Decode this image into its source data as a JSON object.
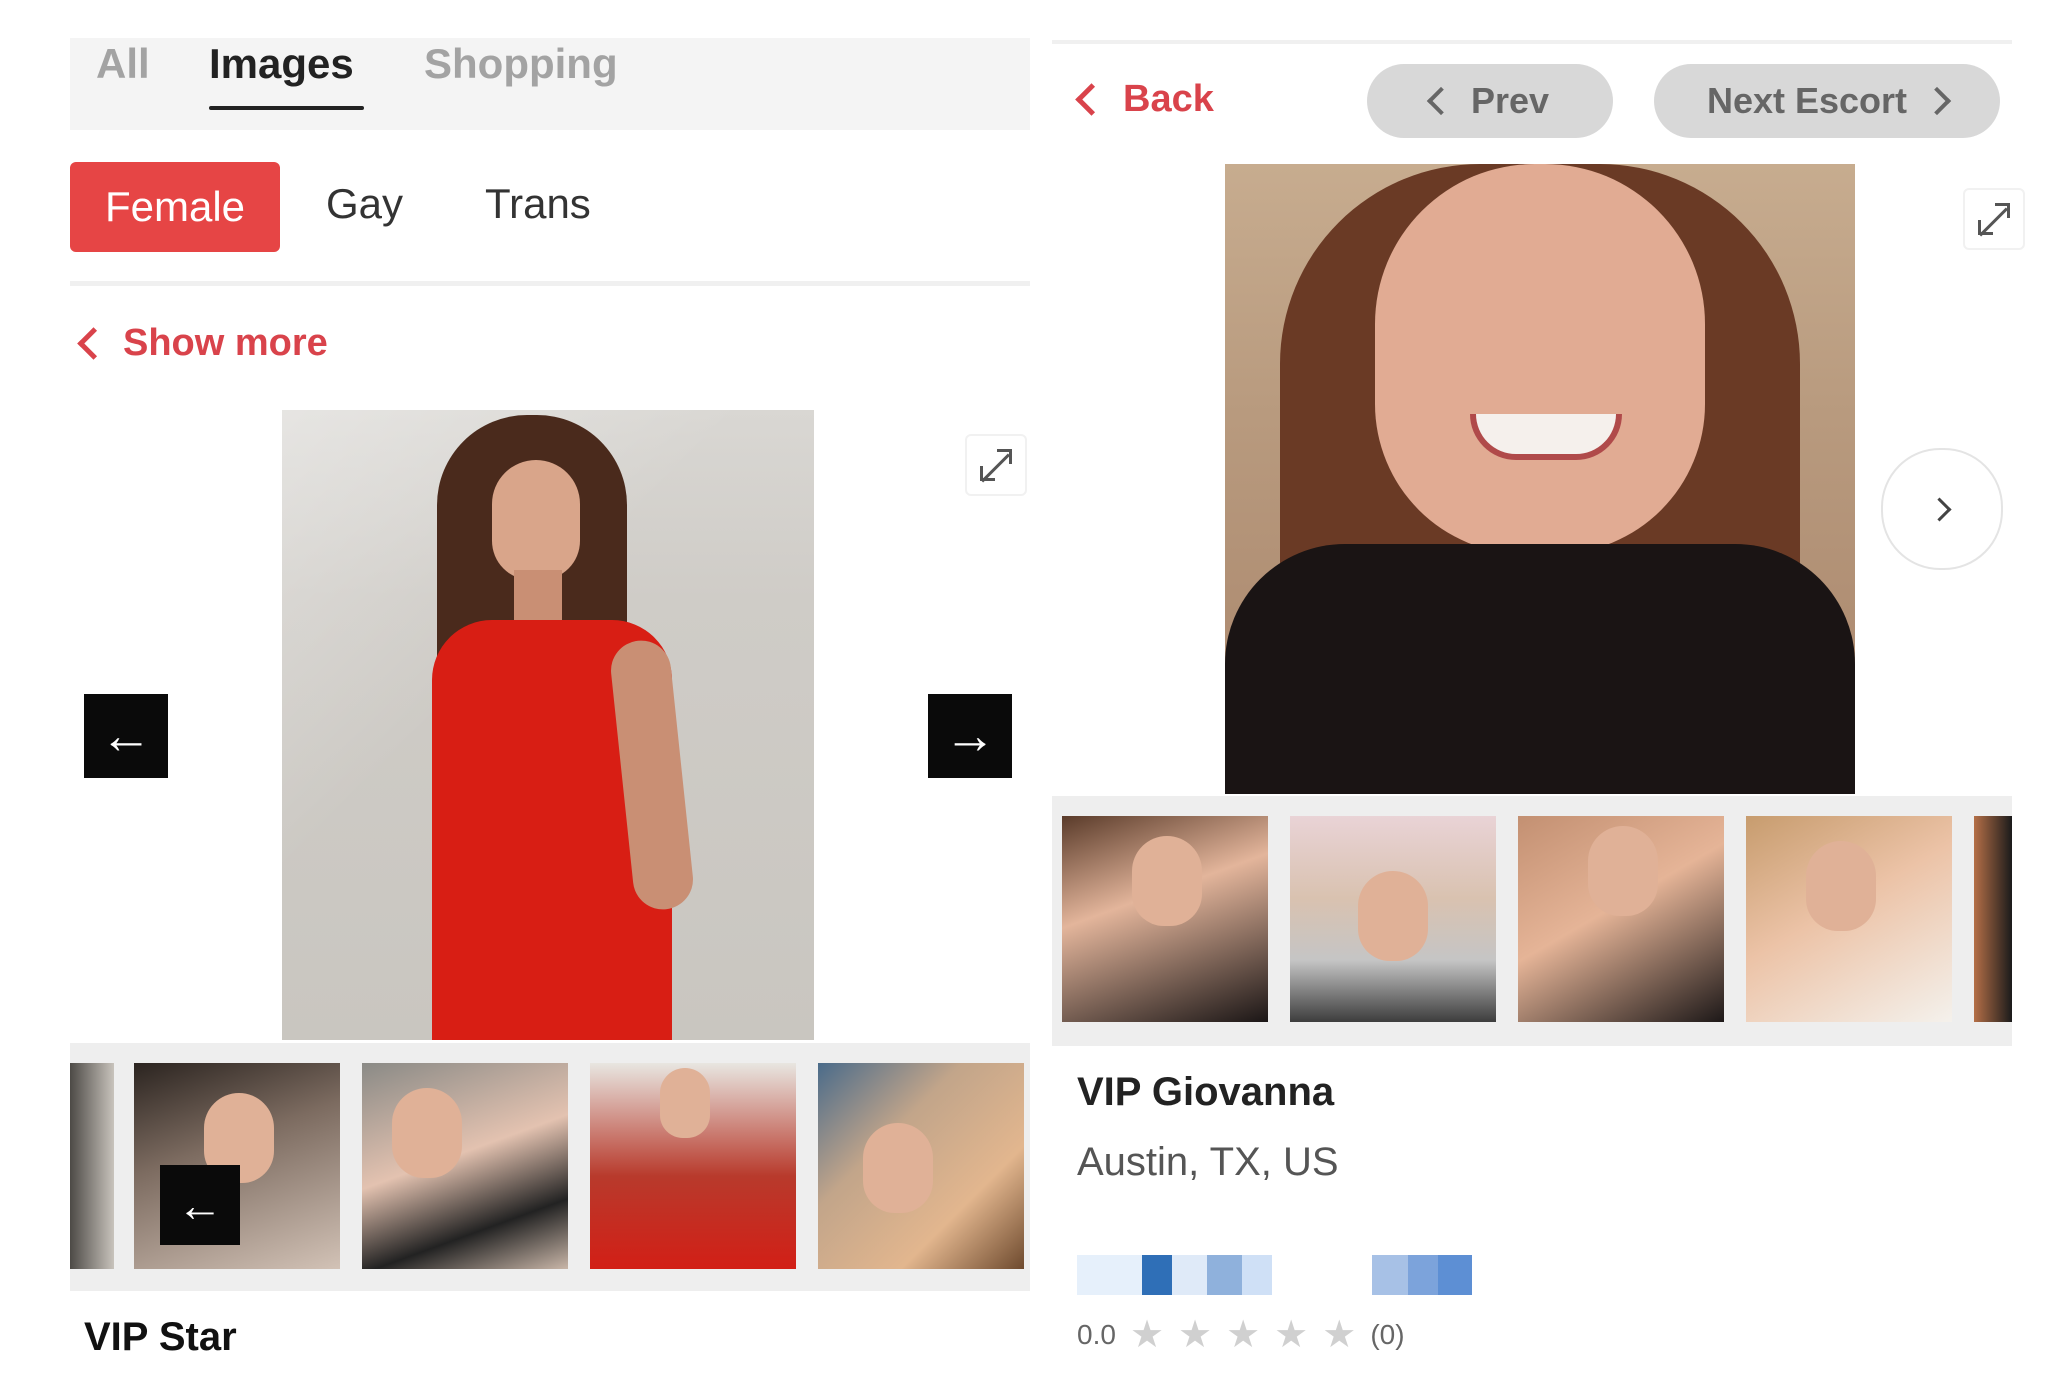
{
  "left": {
    "tabs": [
      {
        "label": "All"
      },
      {
        "label": "Images"
      },
      {
        "label": "Shopping"
      }
    ],
    "gender_filters": [
      {
        "label": "Female",
        "active": true
      },
      {
        "label": "Gay",
        "active": false
      },
      {
        "label": "Trans",
        "active": false
      }
    ],
    "show_more": "Show more",
    "nav": {
      "prev_icon": "arrow-left-icon",
      "next_icon": "arrow-right-icon",
      "expand_icon": "expand-icon"
    },
    "thumbnails_count": 5,
    "profile_name": "VIP Star"
  },
  "right": {
    "back": "Back",
    "prev": "Prev",
    "next": "Next Escort",
    "profile_name": "VIP Giovanna",
    "location": "Austin, TX, US",
    "rating": {
      "score": "0.0",
      "count": "(0)",
      "stars": 5
    },
    "accent": "#d9434b",
    "icons": {
      "expand": "expand-icon",
      "next": "chevron-right-icon"
    }
  }
}
